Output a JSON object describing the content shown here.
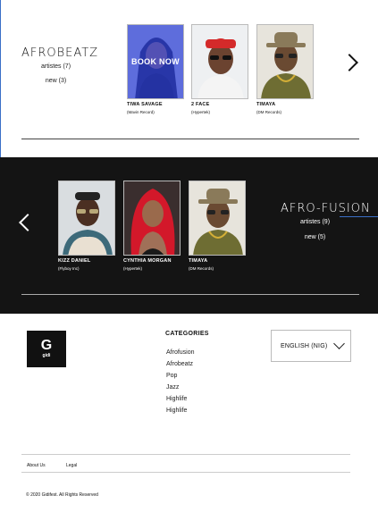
{
  "afrobeatz": {
    "title": "AFROBEATZ",
    "artists_count": "artistes (7)",
    "new_count": "new (3)",
    "artists": [
      {
        "name": "TIWA SAVAGE",
        "label": "(Mavin Record)",
        "overlay": "BOOK NOW"
      },
      {
        "name": "2 FACE",
        "label": "(Hypertek)"
      },
      {
        "name": "TIMAYA",
        "label": "(DM Records)"
      }
    ]
  },
  "afrofusion": {
    "title": "AFRO-FUSION",
    "artists_count": "artistes (9)",
    "new_count": "new (5)",
    "artists": [
      {
        "name": "KIZZ DANIEL",
        "label": "(Flyboy Inc)"
      },
      {
        "name": "CYNTHIA MORGAN",
        "label": "(Hypertek)"
      },
      {
        "name": "TIMAYA",
        "label": "(DM Records)"
      }
    ]
  },
  "footer": {
    "logo_glyph": "G",
    "logo_text": "gidi",
    "categories_title": "CATEGORIES",
    "categories": [
      "Afrofusion",
      "Afrobeatz",
      "Pop",
      "Jazz",
      "Highlife",
      "Highlife"
    ],
    "language": "ENGLISH (NIG)",
    "links": {
      "about": "About Us",
      "legal": "Legal"
    },
    "copyright": "©   2020 Gidifest. All Rights Reserved"
  },
  "icons": {
    "next": "chevron-right-icon",
    "prev": "chevron-left-icon",
    "dropdown": "chevron-down-icon"
  }
}
